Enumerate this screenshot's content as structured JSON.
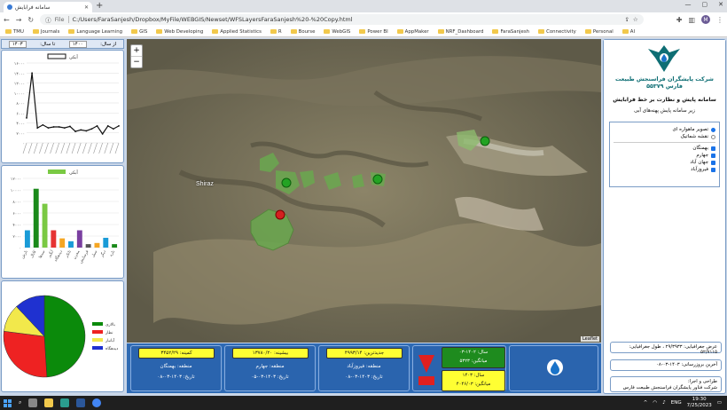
{
  "browser": {
    "tab_title": "سامانه فرابایش",
    "url_prefix": "File",
    "url": "C:/Users/FaraSanjesh/Dropbox/MyFile/WEBGIS/Newset/WFSLayersFaraSanjesh%20-%20Copy.html",
    "avatar": "M",
    "bookmarks": [
      "TMU",
      "Journals",
      "Language Learning",
      "GIS",
      "Web Developing",
      "Applied Statistics",
      "R",
      "Bourse",
      "WebGIS",
      "Power BI",
      "AppMaker",
      "NRF_Dashboard",
      "FaraSanjesh",
      "Connectivity",
      "Personal",
      "AI"
    ]
  },
  "left": {
    "filter": {
      "from_label": "از سال:",
      "from_value": "۱۴۰۰",
      "to_label": "تا سال:",
      "to_value": "۱۴۰۳"
    },
    "line_chart_legend": "آبکی",
    "bar_chart_legend": "آبکی",
    "pie_legend": [
      "بالازی",
      "نطار",
      "آبانبار",
      "دیدهگاه"
    ]
  },
  "chart_data": [
    {
      "type": "line",
      "legend": "آبکی",
      "y_ticks": [
        "۱۶۰۰۰",
        "۱۴۰۰۰",
        "۱۲۰۰۰",
        "۱۰۰۰۰",
        "۸۰۰۰",
        "۶۰۰۰",
        "۴۰۰۰",
        "۲۰۰۰",
        "۰"
      ],
      "ylim": [
        0,
        16000
      ],
      "values": [
        5000,
        14000,
        3000,
        3600,
        3000,
        3200,
        3200,
        3000,
        3300,
        2300,
        2600,
        2400,
        2800,
        3400,
        1800,
        3400,
        2800,
        3400
      ]
    },
    {
      "type": "bar",
      "legend": "آبکی",
      "y_ticks": [
        "۱۲۰۰۰",
        "۱۰۰۰۰",
        "۸۰۰۰",
        "۶۰۰۰",
        "۴۰۰۰",
        "۲۰۰۰",
        "۰"
      ],
      "ylim": [
        0,
        12000
      ],
      "categories": [
        "بارش",
        "کانال",
        "سدها",
        "آبگیر",
        "دیدهگاه",
        "تانکر",
        "مخزن",
        "فرسایش",
        "سیل",
        "دیگر",
        "بازه"
      ],
      "values": [
        3000,
        10200,
        7600,
        3000,
        1600,
        1100,
        3000,
        600,
        800,
        1700,
        600
      ],
      "colors": [
        "#1a9bd7",
        "#1a8a1a",
        "#7ac943",
        "#e63333",
        "#f5a623",
        "#1a9bd7",
        "#7a3fa0",
        "#555555",
        "#f5a623",
        "#1a9bd7",
        "#1a8a1a"
      ]
    },
    {
      "type": "pie",
      "values": [
        49,
        28,
        11,
        12
      ],
      "colors": [
        "#0b8a0b",
        "#ee2222",
        "#f2e84b",
        "#1f31d0"
      ],
      "labels": [
        "بالازی",
        "نطار",
        "آبانبار",
        "دیدهگاه"
      ]
    }
  ],
  "map": {
    "city_label": "Shiraz",
    "zoom_in": "+",
    "zoom_out": "−",
    "attribution": "Leaflet"
  },
  "bottom": {
    "cards": [
      {
        "value": "کمینه: ۳۴۵۲/۲۹",
        "region": "منطقه: بهمنگان",
        "date": "تاریخ: ۱۴۰۳-۰۳-۰۸"
      },
      {
        "value": "بیشینه: ۱۳۷۸۰/۲۰",
        "region": "منطقه: جهارم",
        "date": "تاریخ: ۱۴۰۳-۰۳-۰۵"
      },
      {
        "value": "جدیدترین: ۴۹۹۳/۱۴",
        "region": "منطقه: فیروزآباد",
        "date": "تاریخ: ۱۴۰۳-۰۳-۰۸"
      }
    ],
    "year_card": {
      "year1": "سال: ۱۴۰۲-۰۳",
      "avg1": "میانگین: ۵۳۲۳",
      "year2": "سال: ۱۴۰۳",
      "avg2": "میانگین: ۴۰۴۶/۰۳"
    }
  },
  "right": {
    "company": "شرکت پایشگران فراسنجش طبیعت فارس ۵۵۳۷۹",
    "title": "سامانه پایش و نظارت بر خط فرابایش",
    "subtitle": "زیر سامانه پایش پهنه‌های آبی",
    "basemap": [
      {
        "label": "تصویر ماهواره ای",
        "on": true
      },
      {
        "label": "نقشه شماتیک",
        "on": false
      }
    ],
    "layers": [
      "بهمنگان",
      "جهارم",
      "جهان آباد",
      "فیروزآباد"
    ],
    "coords": "عرض جغرافیایی: ۲۹/۳۹۳۳ ، طول جغرافیایی: ۵۲/۷۱۱۵",
    "last_update": "آخرین بروزرسانی: ۱۴۰۳-۰۳-۰۸",
    "design_title": "طراحی و اجرا:",
    "design_company": "شرکت فناور پایشگران فراسنجش طبیعت فارس"
  },
  "taskbar": {
    "lang": "ENG",
    "time": "19:30",
    "date": "7/25/2023"
  }
}
